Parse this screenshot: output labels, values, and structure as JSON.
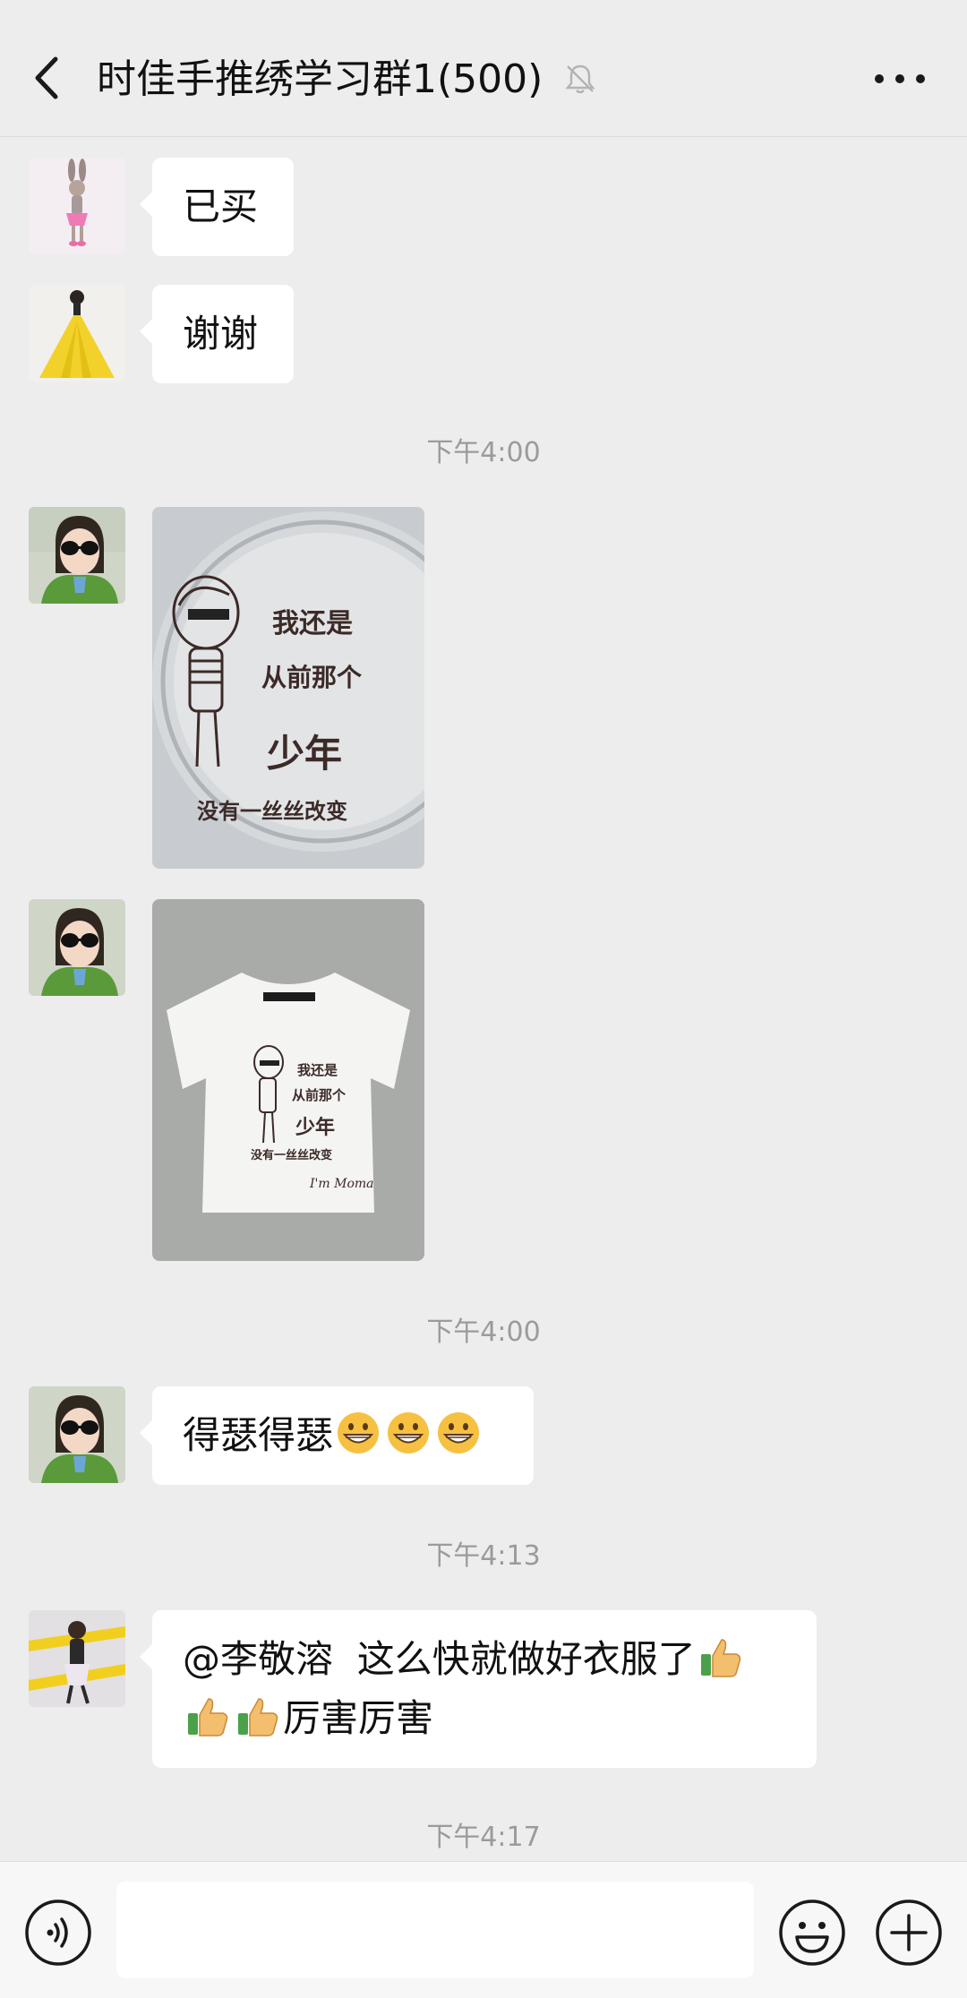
{
  "header": {
    "title": "时佳手推绣学习群1(500)"
  },
  "messages": {
    "m1": {
      "text": "已买"
    },
    "m2": {
      "text": "谢谢"
    },
    "ts1": "下午4:00",
    "m3": {
      "image": "embroidered-design-hoop-photo"
    },
    "m4": {
      "image": "embroidered-tshirt-photo"
    },
    "ts2": "下午4:00",
    "m5": {
      "text": "得瑟得瑟",
      "emojis": [
        "grin-emoji",
        "grin-emoji",
        "grin-emoji"
      ]
    },
    "ts3": "下午4:13",
    "m6": {
      "mention": "@李敬溶",
      "line1_text": "这么快就做好衣服了",
      "line2_text": "厉害厉害",
      "emojis": [
        "thumbs-up-emoji",
        "thumbs-up-emoji",
        "thumbs-up-emoji"
      ]
    },
    "ts4": "下午4:17"
  },
  "embroidery_text": {
    "line1": "我还是",
    "line2": "从前那个",
    "line3": "少年",
    "line4": "没有一丝丝改变",
    "signature": "I'm Moma"
  },
  "input": {
    "placeholder": ""
  },
  "icons": {
    "back": "chevron-left-icon",
    "mute": "bell-slash-icon",
    "more": "more-dots-icon",
    "voice": "voice-icon",
    "emoji": "smiley-icon",
    "plus": "plus-circle-icon"
  },
  "colors": {
    "background": "#ededed",
    "bubble": "#ffffff",
    "timestamp": "#9b9b9b",
    "input_bar": "#f7f7f7"
  }
}
